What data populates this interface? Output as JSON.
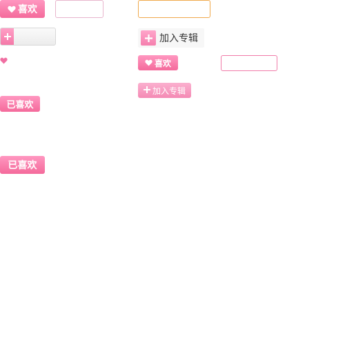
{
  "buttons": {
    "like": "喜欢",
    "liked": "已喜欢",
    "add_album": "加入专辑"
  },
  "icons": {
    "heart": "heart-icon",
    "plus": "plus-icon"
  },
  "colors": {
    "pink_accent": "#f46a9b",
    "pink_light": "#ff97c0",
    "orange_border": "#f0a84a",
    "pink_border": "#f07aa8"
  }
}
